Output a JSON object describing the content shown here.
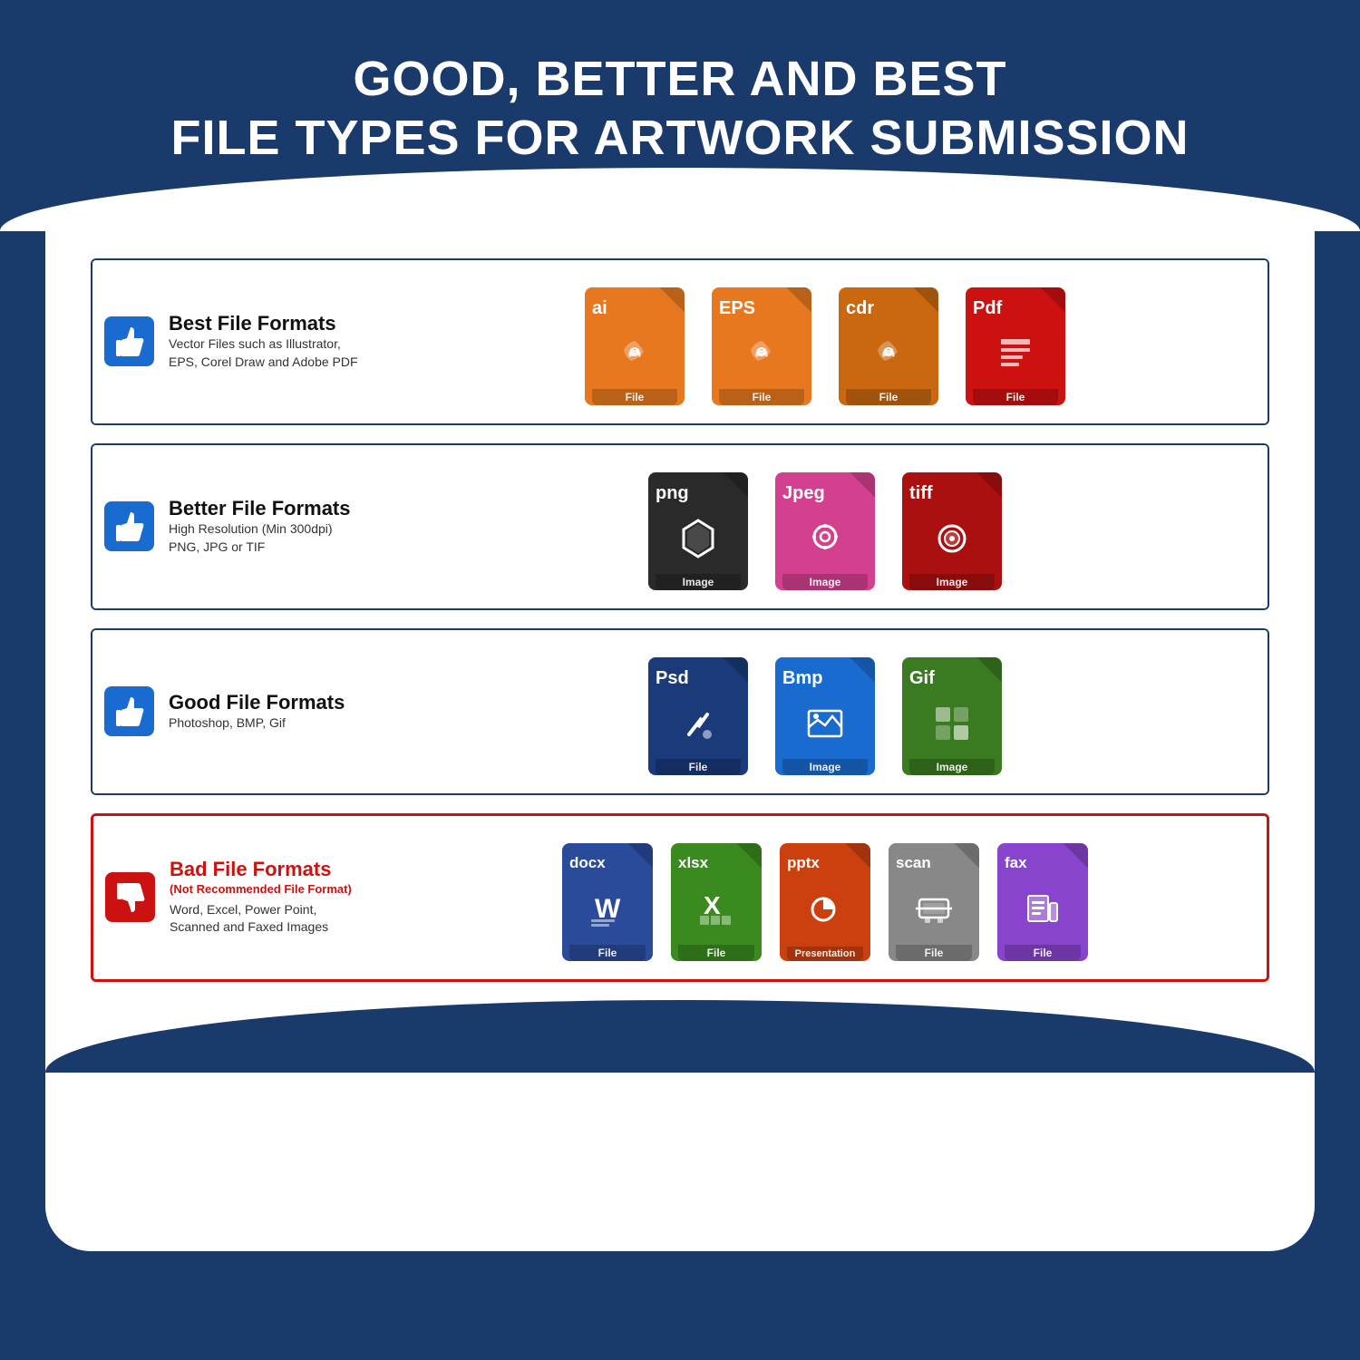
{
  "header": {
    "line1": "GOOD, BETTER AND BEST",
    "line2": "FILE TYPES FOR ARTWORK SUBMISSION"
  },
  "rows": [
    {
      "id": "best",
      "thumb": "up",
      "title": "Best File Formats",
      "subtitle": null,
      "description": "Vector Files such as Illustrator, EPS, Corel Draw and Adobe PDF",
      "icons": [
        {
          "ext": "ai",
          "label": "File",
          "color": "orange",
          "graphic": "pen"
        },
        {
          "ext": "EPS",
          "label": "File",
          "color": "orange",
          "graphic": "pen"
        },
        {
          "ext": "cdr",
          "label": "File",
          "color": "dark-orange",
          "graphic": "pen"
        },
        {
          "ext": "Pdf",
          "label": "File",
          "color": "red",
          "graphic": "doc"
        }
      ]
    },
    {
      "id": "better",
      "thumb": "up",
      "title": "Better File Formats",
      "subtitle": null,
      "description": "High Resolution (Min 300dpi) PNG, JPG or TIF",
      "icons": [
        {
          "ext": "png",
          "label": "Image",
          "color": "black",
          "graphic": "star"
        },
        {
          "ext": "Jpeg",
          "label": "Image",
          "color": "pink",
          "graphic": "camera"
        },
        {
          "ext": "tiff",
          "label": "Image",
          "color": "tiff-red",
          "graphic": "flower"
        }
      ]
    },
    {
      "id": "good",
      "thumb": "up",
      "title": "Good File Formats",
      "subtitle": null,
      "description": "Photoshop, BMP, Gif",
      "icons": [
        {
          "ext": "Psd",
          "label": "File",
          "color": "navy",
          "graphic": "brush"
        },
        {
          "ext": "Bmp",
          "label": "Image",
          "color": "blue",
          "graphic": "landscape"
        },
        {
          "ext": "Gif",
          "label": "Image",
          "color": "green",
          "graphic": "grid"
        }
      ]
    },
    {
      "id": "bad",
      "thumb": "down",
      "title": "Bad File Formats",
      "subtitle": "(Not Recommended File Format)",
      "description": "Word, Excel, Power Point, Scanned and Faxed Images",
      "icons": [
        {
          "ext": "docx",
          "label": "File",
          "color": "word-blue",
          "graphic": "word"
        },
        {
          "ext": "xlsx",
          "label": "File",
          "color": "excel-green",
          "graphic": "excel"
        },
        {
          "ext": "pptx",
          "label": "Presentation",
          "color": "ppt-red",
          "graphic": "ppt"
        },
        {
          "ext": "scan",
          "label": "File",
          "color": "scan-gray",
          "graphic": "scan"
        },
        {
          "ext": "fax",
          "label": "File",
          "color": "fax-purple",
          "graphic": "fax"
        }
      ]
    }
  ]
}
